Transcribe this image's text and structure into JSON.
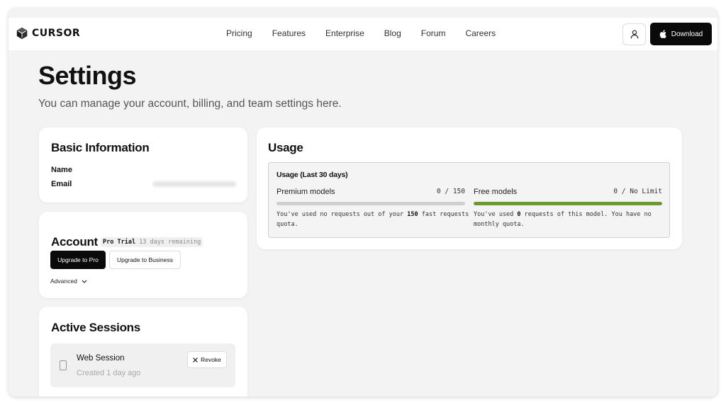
{
  "brand": {
    "name": "CURSOR",
    "logo_icon": "cube-logo-icon"
  },
  "nav": {
    "links": [
      "Pricing",
      "Features",
      "Enterprise",
      "Blog",
      "Forum",
      "Careers"
    ],
    "user_icon": "user-icon",
    "download_label": "Download",
    "download_icon": "apple-icon"
  },
  "page": {
    "title": "Settings",
    "subtitle": "You can manage your account, billing, and team settings here."
  },
  "basic_info": {
    "title": "Basic Information",
    "name_label": "Name",
    "email_label": "Email"
  },
  "account": {
    "title": "Account",
    "plan": "Pro Trial",
    "trial_remaining": "13 days remaining",
    "upgrade_pro_label": "Upgrade to Pro",
    "upgrade_business_label": "Upgrade to Business",
    "advanced_label": "Advanced"
  },
  "sessions": {
    "title": "Active Sessions",
    "items": [
      {
        "name": "Web Session",
        "created": "Created 1 day ago",
        "revoke_label": "Revoke"
      }
    ]
  },
  "usage": {
    "title": "Usage",
    "box_title": "Usage (Last 30 days)",
    "premium": {
      "name": "Premium models",
      "count": "0 / 150",
      "fill_fraction": 0,
      "desc_pre": "You've used no requests out of your ",
      "desc_bold": "150",
      "desc_post": " fast requests quota."
    },
    "free": {
      "name": "Free models",
      "count": "0 / No Limit",
      "fill_fraction": 1,
      "desc_pre": "You've used ",
      "desc_bold": "0",
      "desc_post": " requests of this model. You have no monthly quota."
    }
  },
  "colors": {
    "progress_free": "#6b9a2e",
    "button_dark": "#0a0a0a",
    "page_background": "#f3f3f3"
  }
}
